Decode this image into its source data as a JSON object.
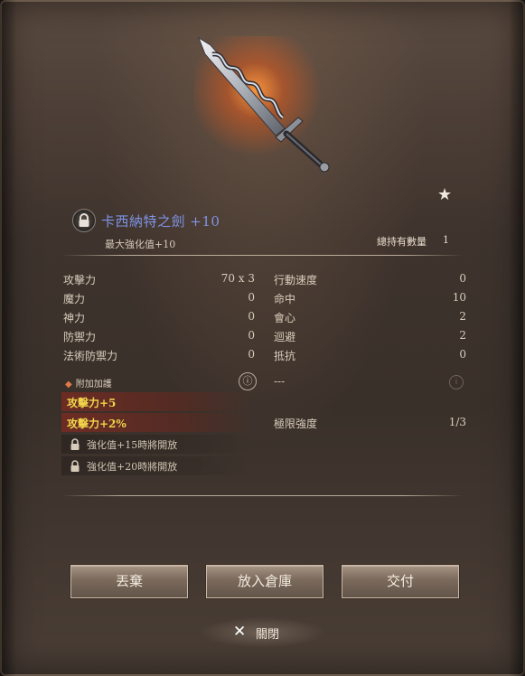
{
  "item": {
    "name": "卡西納特之劍 +10",
    "max_enhancement": "最大強化值+10",
    "hold_label": "總持有數量",
    "hold_count": "1",
    "favorite_icon": "star-icon"
  },
  "stats_left": [
    {
      "label": "攻擊力",
      "value": "70 x 3"
    },
    {
      "label": "魔力",
      "value": "0"
    },
    {
      "label": "神力",
      "value": "0"
    },
    {
      "label": "防禦力",
      "value": "0"
    },
    {
      "label": "法術防禦力",
      "value": "0"
    }
  ],
  "stats_right": [
    {
      "label": "行動速度",
      "value": "0"
    },
    {
      "label": "命中",
      "value": "10"
    },
    {
      "label": "會心",
      "value": "2"
    },
    {
      "label": "迴避",
      "value": "2"
    },
    {
      "label": "抵抗",
      "value": "0"
    }
  ],
  "bonus": {
    "title": "附加加護",
    "active": [
      "攻擊力+5",
      "攻擊力+2%"
    ],
    "locked": [
      "強化值+15時將開放",
      "強化值+20時將開放"
    ],
    "right_placeholder": "---",
    "limit_label": "極限強度",
    "limit_value": "1/3"
  },
  "buttons": {
    "discard": "丟棄",
    "store": "放入倉庫",
    "deliver": "交付",
    "close": "關閉"
  },
  "colors": {
    "item_name": "#7f93e6",
    "bonus_text": "#f1d54a",
    "sword_glow": "#e06a25"
  }
}
